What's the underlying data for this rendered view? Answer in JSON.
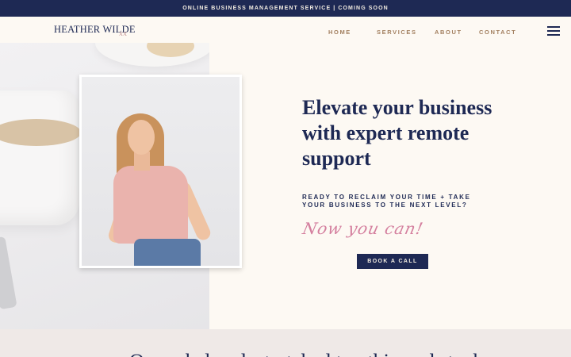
{
  "announcement": "ONLINE BUSINESS MANAGEMENT SERVICE | COMING SOON",
  "brand": {
    "name": "HEATHER WILDE",
    "mark": "xx"
  },
  "nav": {
    "home": "HOME",
    "services": "SERVICES",
    "about": "ABOUT",
    "contact": "CONTACT"
  },
  "hero": {
    "title": "Elevate your business with expert remote support",
    "subtitle": "READY TO RECLAIM YOUR TIME + TAKE YOUR BUSINESS TO THE NEXT LEVEL?",
    "script": "Now you can!",
    "cta": "BOOK A CALL"
  },
  "next_section": {
    "heading": "Overwhelmed, stretched too thin and stuck"
  },
  "colors": {
    "navy": "#1e2954",
    "cream": "#fdf9f3",
    "gold": "#a27f5f",
    "pink": "#d47f9e"
  },
  "icons": {
    "menu": "hamburger-menu-icon"
  }
}
